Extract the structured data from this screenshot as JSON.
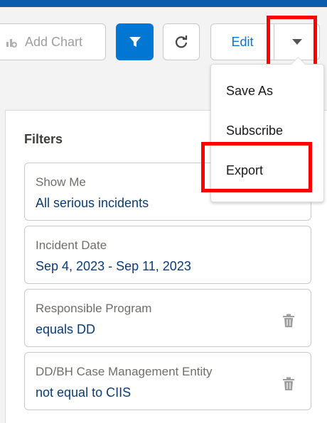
{
  "toolbar": {
    "add_chart_label": "Add Chart",
    "add_chart_icon": "add-chart-icon",
    "filter_icon": "filter-icon",
    "refresh_icon": "refresh-icon",
    "edit_label": "Edit",
    "menu_icon": "chevron-down-icon",
    "accent_color": "#0176d3"
  },
  "menu": {
    "items": [
      {
        "label": "Save As"
      },
      {
        "label": "Subscribe"
      },
      {
        "label": "Export"
      }
    ]
  },
  "filters": {
    "title": "Filters",
    "items": [
      {
        "label": "Show Me",
        "value": "All serious incidents",
        "removable": false
      },
      {
        "label": "Incident Date",
        "value": "Sep 4, 2023 - Sep 11, 2023",
        "removable": false
      },
      {
        "label": "Responsible Program",
        "value": "equals DD",
        "removable": true
      },
      {
        "label": "DD/BH Case Management Entity",
        "value": "not equal to CIIS",
        "removable": true
      }
    ]
  },
  "annotations": {
    "highlight_color": "#ff0000"
  }
}
